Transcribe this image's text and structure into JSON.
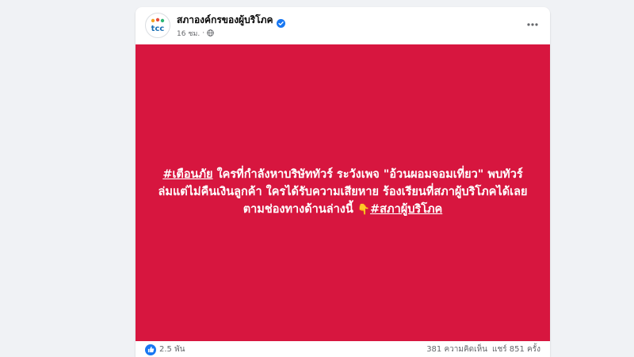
{
  "header": {
    "page_name": "สภาองค์กรของผู้บริโภค",
    "logo_text": "tcc",
    "timestamp": "16 ชม.",
    "separator": "·",
    "privacy_icon": "globe-icon",
    "verified_icon": "verified-badge-icon",
    "more_icon": "more-horizontal-icon"
  },
  "post": {
    "background_color": "#d7163f",
    "hashtag_1": "#เตือนภัย",
    "text_main": " ใครที่กำลังหาบริษัททัวร์ ระวังเพจ \"อ้วนผอมจอมเที่ยว\" พบทัวร์ล่มแต่ไม่คืนเงินลูกค้า ใครได้รับความเสียหาย ร้องเรียนที่สภาผู้บริโภคได้เลย ตามช่องทางด้านล่างนี้",
    "emoji": "👇",
    "hashtag_2": "#สภาผู้บริโภค"
  },
  "footer": {
    "reaction_icon": "like-icon",
    "reaction_count": "2.5 พัน",
    "comments": "381 ความคิดเห็น",
    "shares": "แชร์ 851 ครั้ง"
  },
  "colors": {
    "brand_blue": "#1877f2",
    "post_red": "#d7163f",
    "page_bg": "#f0f2f5"
  }
}
